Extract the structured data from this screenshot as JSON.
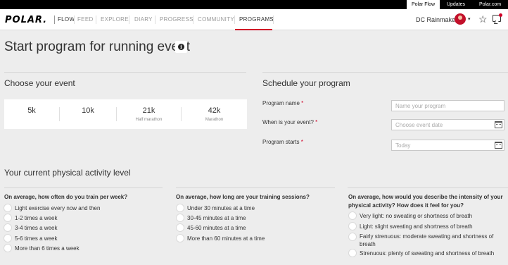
{
  "topbar": {
    "links": [
      "Polar Flow",
      "Updates",
      "Polar.com"
    ]
  },
  "header": {
    "logo": "POLAR.",
    "nav": [
      "FLOW",
      "FEED",
      "EXPLORE",
      "DIARY",
      "PROGRESS",
      "COMMUNITY",
      "PROGRAMS"
    ],
    "active_nav": "PROGRAMS",
    "user_name": "DC Rainmaker",
    "caret": "▾",
    "star": "☆",
    "accent_color": "#d10027"
  },
  "page": {
    "title": "Start program for running event",
    "info": "i"
  },
  "choose_event": {
    "title": "Choose your event",
    "events": [
      {
        "value": "5k",
        "sub": ""
      },
      {
        "value": "10k",
        "sub": ""
      },
      {
        "value": "21k",
        "sub": "Half marathon"
      },
      {
        "value": "42k",
        "sub": "Marathon"
      }
    ]
  },
  "schedule": {
    "title": "Schedule your program",
    "fields": [
      {
        "label": "Program name",
        "required": "*",
        "placeholder": "Name your program",
        "icon": ""
      },
      {
        "label": "When is your event?",
        "required": "*",
        "placeholder": "Choose event date",
        "icon": "calendar-icon"
      },
      {
        "label": "Program starts",
        "required": "*",
        "placeholder": "Today",
        "icon": "calendar-icon"
      }
    ]
  },
  "activity": {
    "title": "Your current physical activity level",
    "questions": [
      {
        "question": "On average, how often do you train per week?",
        "options": [
          "Light exercise every now and then",
          "1-2 times a week",
          "3-4 times a week",
          "5-6 times a week",
          "More than 6 times a week"
        ]
      },
      {
        "question": "On average, how long are your training sessions?",
        "options": [
          "Under 30 minutes at a time",
          "30-45 minutes at a time",
          "45-60 minutes at a time",
          "More than 60 minutes at a time"
        ]
      },
      {
        "question": "On average, how would you describe the intensity of your physical activity? How does it feel for you?",
        "options": [
          "Very light: no sweating or shortness of breath",
          "Light: slight sweating and shortness of breath",
          "Fairly strenuous: moderate sweating and shortness of breath",
          "Strenuous: plenty of sweating and shortness of breath"
        ]
      }
    ]
  }
}
